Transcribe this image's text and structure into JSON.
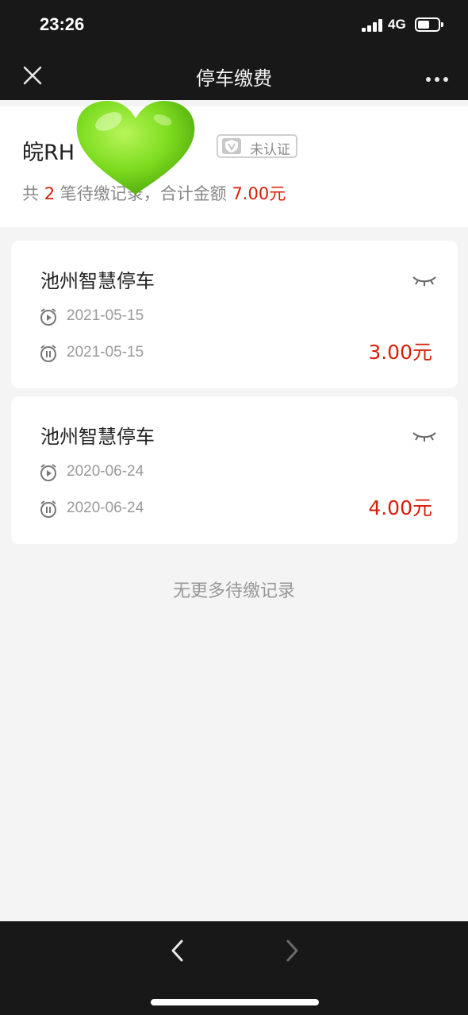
{
  "status_bar": {
    "time": "23:26",
    "network": "4G"
  },
  "nav": {
    "title": "停车缴费",
    "close_icon": "close-icon",
    "more_icon": "more-icon"
  },
  "plate": {
    "number": "皖RH",
    "badge_label": "未认证",
    "summary_prefix": "共",
    "count": "2",
    "summary_middle": "笔待缴",
    "summary_hidden_tail": "记录",
    "summary_suffix": "，合计金额",
    "total": "7.00元"
  },
  "records": [
    {
      "title": "池州智慧停车",
      "start_date": "2021-05-15",
      "end_date": "2021-05-15",
      "amount": "3.00元"
    },
    {
      "title": "池州智慧停车",
      "start_date": "2020-06-24",
      "end_date": "2020-06-24",
      "amount": "4.00元"
    }
  ],
  "footer_note": "无更多待缴记录",
  "colors": {
    "accent_red": "#d81e06",
    "sticker_green": "#7ddc1f",
    "bar_dark": "#181818"
  }
}
